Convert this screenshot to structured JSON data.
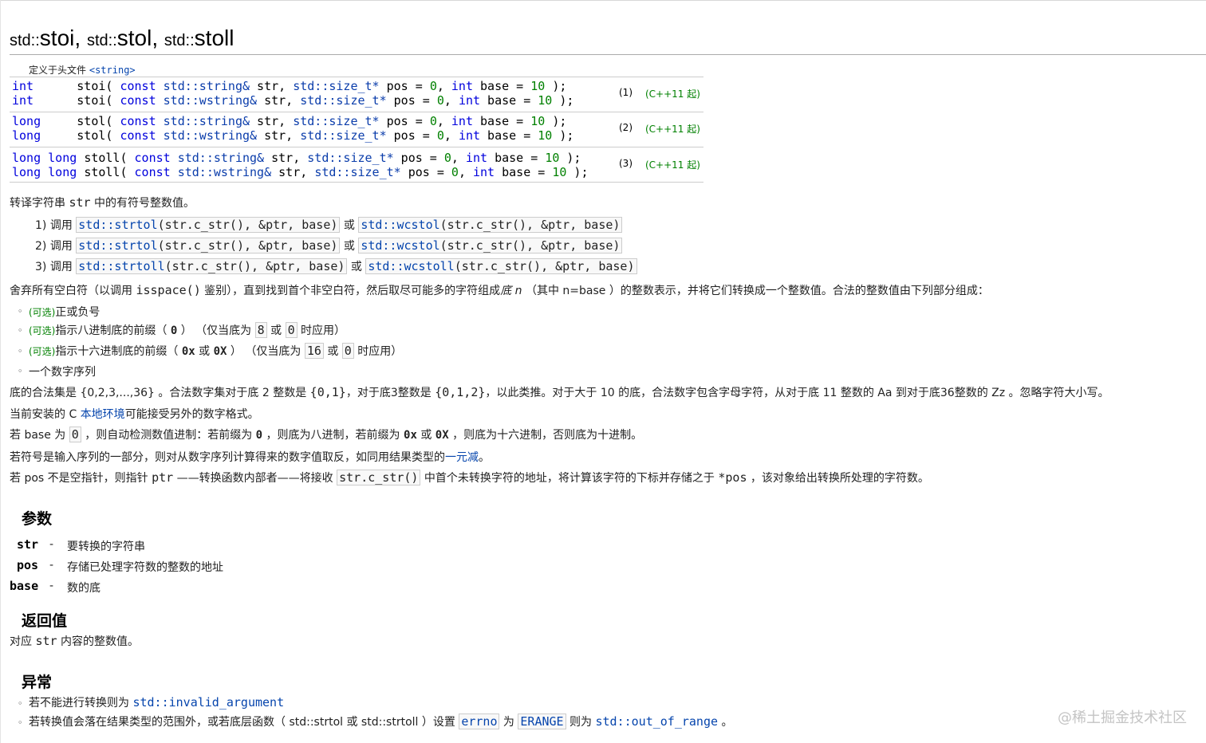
{
  "title": {
    "ns1": "std::",
    "name1": "stoi",
    "sep1": ", ",
    "ns2": "std::",
    "name2": "stol",
    "sep2": ", ",
    "ns3": "std::",
    "name3": "stoll"
  },
  "header_label": "定义于头文件",
  "header_file": "<string>",
  "declarations": [
    {
      "ret": "int      ",
      "name": "stoi",
      "str_type": "std::string&",
      "pos_type": "std::size_t*",
      "num": "(1)",
      "since": "(C++11 起)"
    },
    {
      "ret": "int      ",
      "name": "stoi",
      "str_type": "std::wstring&",
      "pos_type": "std::size_t*"
    },
    {
      "ret": "long     ",
      "name": "stol",
      "str_type": "std::string&",
      "pos_type": "std::size_t*",
      "num": "(2)",
      "since": "(C++11 起)"
    },
    {
      "ret": "long     ",
      "name": "stol",
      "str_type": "std::wstring&",
      "pos_type": "std::size_t*"
    },
    {
      "ret": "long long ",
      "name": "stoll",
      "str_type": "std::string&",
      "pos_type": "std::size_t*",
      "num": "(3)",
      "since": "(C++11 起)"
    },
    {
      "ret": "long long ",
      "name": "stoll",
      "str_type": "std::wstring&",
      "pos_type": "std::size_t*"
    }
  ],
  "decl_common": {
    "open": "( ",
    "const": "const",
    "str_name": " str, ",
    "pos_name": " pos = ",
    "zero": "0",
    "comma": ", ",
    "int_kw": "int",
    "base": " base = ",
    "ten": "10",
    "close": " );"
  },
  "intro": {
    "a": "转译字符串 ",
    "b": "str",
    "c": " 中的有符号整数值。"
  },
  "calls": [
    {
      "n": "1) 调用 ",
      "f1": "std::strtol",
      "a1": "(str.c_str(), &ptr, base)",
      "or": " 或 ",
      "f2": "std::wcstol",
      "a2": "(str.c_str(), &ptr, base)"
    },
    {
      "n": "2) 调用 ",
      "f1": "std::strtol",
      "a1": "(str.c_str(), &ptr, base)",
      "or": " 或 ",
      "f2": "std::wcstol",
      "a2": "(str.c_str(), &ptr, base)"
    },
    {
      "n": "3) 调用 ",
      "f1": "std::strtoll",
      "a1": "(str.c_str(), &ptr, base)",
      "or": " 或 ",
      "f2": "std::wcstoll",
      "a2": "(str.c_str(), &ptr, base)"
    }
  ],
  "discard": {
    "a": "舍弃所有空白符（以调用 ",
    "b": "isspace()",
    "c": " 鉴别），直到找到首个非空白符，然后取尽可能多的字符组成",
    "d": "底 n",
    "e": " （其中 n=base ）的整数表示，并将它们转换成一个整数值。合法的整数值由下列部分组成："
  },
  "bullets": {
    "b1_opt": "(可选)",
    "b1": "正或负号",
    "b2_opt": "(可选)",
    "b2a": "指示八进制底的前缀（ ",
    "b2_zero": "0",
    "b2b": " ） （仅当底为 ",
    "b2_8": "8",
    "b2_or": " 或 ",
    "b2_0": "0",
    "b2c": " 时应用）",
    "b3_opt": "(可选)",
    "b3a": "指示十六进制底的前缀（ ",
    "b3_0x": "0x",
    "b3_or1": " 或 ",
    "b3_0X": "0X",
    "b3b": " ） （仅当底为 ",
    "b3_16": "16",
    "b3_or2": " 或 ",
    "b3_0": "0",
    "b3c": " 时应用）",
    "b4": "一个数字序列",
    "marker": "◦"
  },
  "paragraphs": {
    "p1a": "底的合法集是 {0,2,3,...,36} 。合法数字集对于底 2 整数是 ",
    "p1_set2": "{0,1}",
    "p1b": "，对于底3整数是 ",
    "p1_set3": "{0,1,2}",
    "p1c": "，以此类推。对于大于 10 的底，合法数字包含字母字符，从对于底 11 整数的 Aa 到对于底36整数的 Zz 。忽略字符大小写。",
    "p2a": "当前安装的 C ",
    "p2_link": "本地环境",
    "p2b": "可能接受另外的数字格式。",
    "p3a": "若 base 为 ",
    "p3_0": "0",
    "p3b": " ，则自动检测数值进制：若前缀为 ",
    "p3_z": "0",
    "p3c": " ，则底为八进制，若前缀为 ",
    "p3_0x": "0x",
    "p3_or": " 或 ",
    "p3_0X": "0X",
    "p3d": " ，则底为十六进制，否则底为十进制。",
    "p4a": "若符号是输入序列的一部分，则对从数字序列计算得来的数字值取反，如同用结果类型的",
    "p4_link": "一元减",
    "p4b": "。",
    "p5a": "若 pos 不是空指针，则指针 ",
    "p5_ptr": "ptr",
    "p5b": " ——转换函数内部者——将接收 ",
    "p5_code": "str.c_str()",
    "p5c": " 中首个未转换字符的地址，将计算该字符的下标并存储之于 ",
    "p5_pos": "*pos",
    "p5d": " ，该对象给出转换所处理的字符数。"
  },
  "params": {
    "heading": "参数",
    "items": [
      {
        "name": "str",
        "dash": "-",
        "desc": "要转换的字符串"
      },
      {
        "name": "pos",
        "dash": "-",
        "desc": "存储已处理字符数的整数的地址"
      },
      {
        "name": "base",
        "dash": "-",
        "desc": "数的底"
      }
    ]
  },
  "returns": {
    "heading": "返回值",
    "a": "对应 ",
    "b": "str",
    "c": " 内容的整数值。"
  },
  "exceptions": {
    "heading": "异常",
    "e1a": "若不能进行转换则为 ",
    "e1_link": "std::invalid_argument",
    "e2a": "若转换值会落在结果类型的范围外，或若底层函数（ std::strtol 或 std::strtoll ）设置 ",
    "e2_errno": "errno",
    "e2b": " 为 ",
    "e2_erange": "ERANGE",
    "e2c": " 则为 ",
    "e2_link": "std::out_of_range",
    "e2d": " 。"
  },
  "watermark": "@稀土掘金技术社区"
}
